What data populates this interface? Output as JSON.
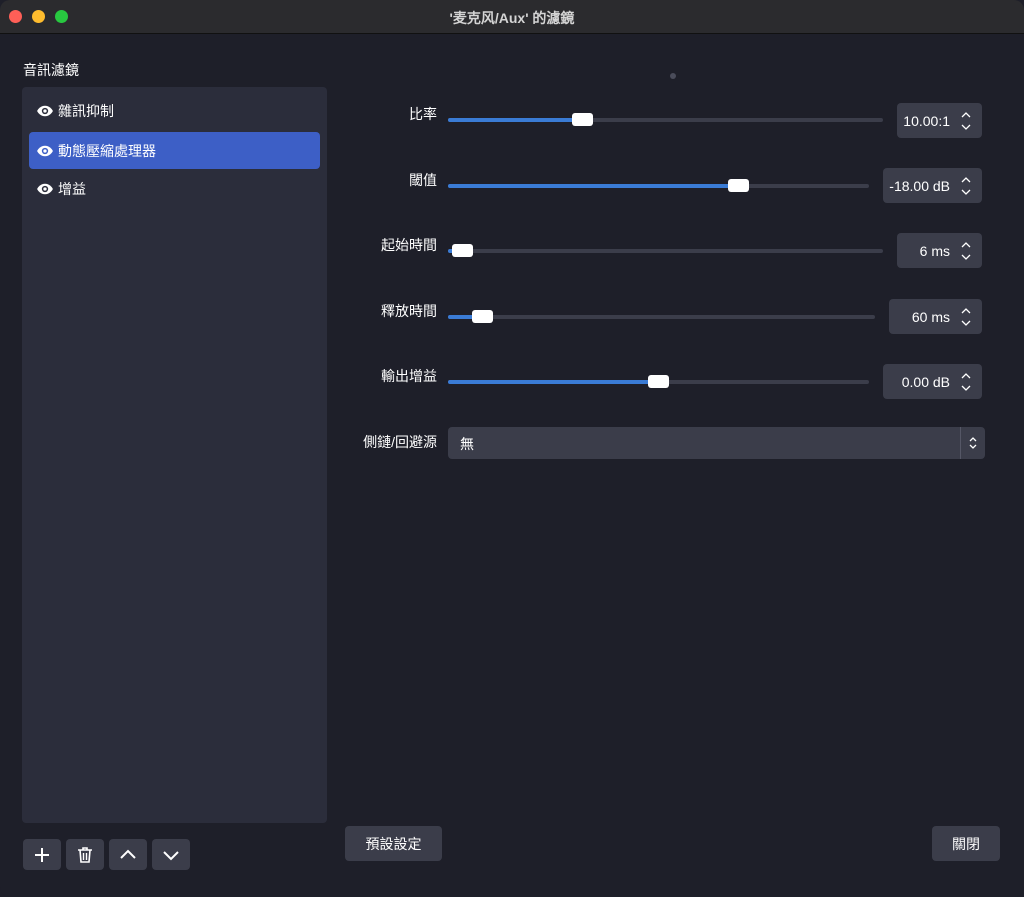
{
  "window": {
    "title": "'麦克风/Aux' 的濾鏡"
  },
  "filters_panel": {
    "label": "音訊濾鏡",
    "items": [
      {
        "label": "雜訊抑制",
        "selected": false
      },
      {
        "label": "動態壓縮處理器",
        "selected": true
      },
      {
        "label": "增益",
        "selected": false
      }
    ],
    "buttons": {
      "add_icon": "plus-icon",
      "remove_icon": "trash-icon",
      "move_up_icon": "chevron-up-icon",
      "move_down_icon": "chevron-down-icon"
    }
  },
  "settings": {
    "ratio": {
      "label": "比率",
      "value": "10.00:1",
      "level": 0.3
    },
    "threshold": {
      "label": "閾值",
      "value": "-18.00 dB",
      "level": 0.7
    },
    "attack": {
      "label": "起始時間",
      "value": "6 ms",
      "level": 0.01
    },
    "release": {
      "label": "釋放時間",
      "value": "60 ms",
      "level": 0.06
    },
    "output_gain": {
      "label": "輸出增益",
      "value": "0.00 dB",
      "level": 0.5
    },
    "sidechain": {
      "label": "側鏈/回避源",
      "value": "無"
    }
  },
  "footer": {
    "defaults_label": "預設設定",
    "close_label": "關閉"
  },
  "colors": {
    "accent": "#3a7bd5",
    "selection": "#3d5fc6",
    "background": "#1e1f29",
    "panel": "#2b2d3b",
    "control": "#3b3d4a"
  }
}
